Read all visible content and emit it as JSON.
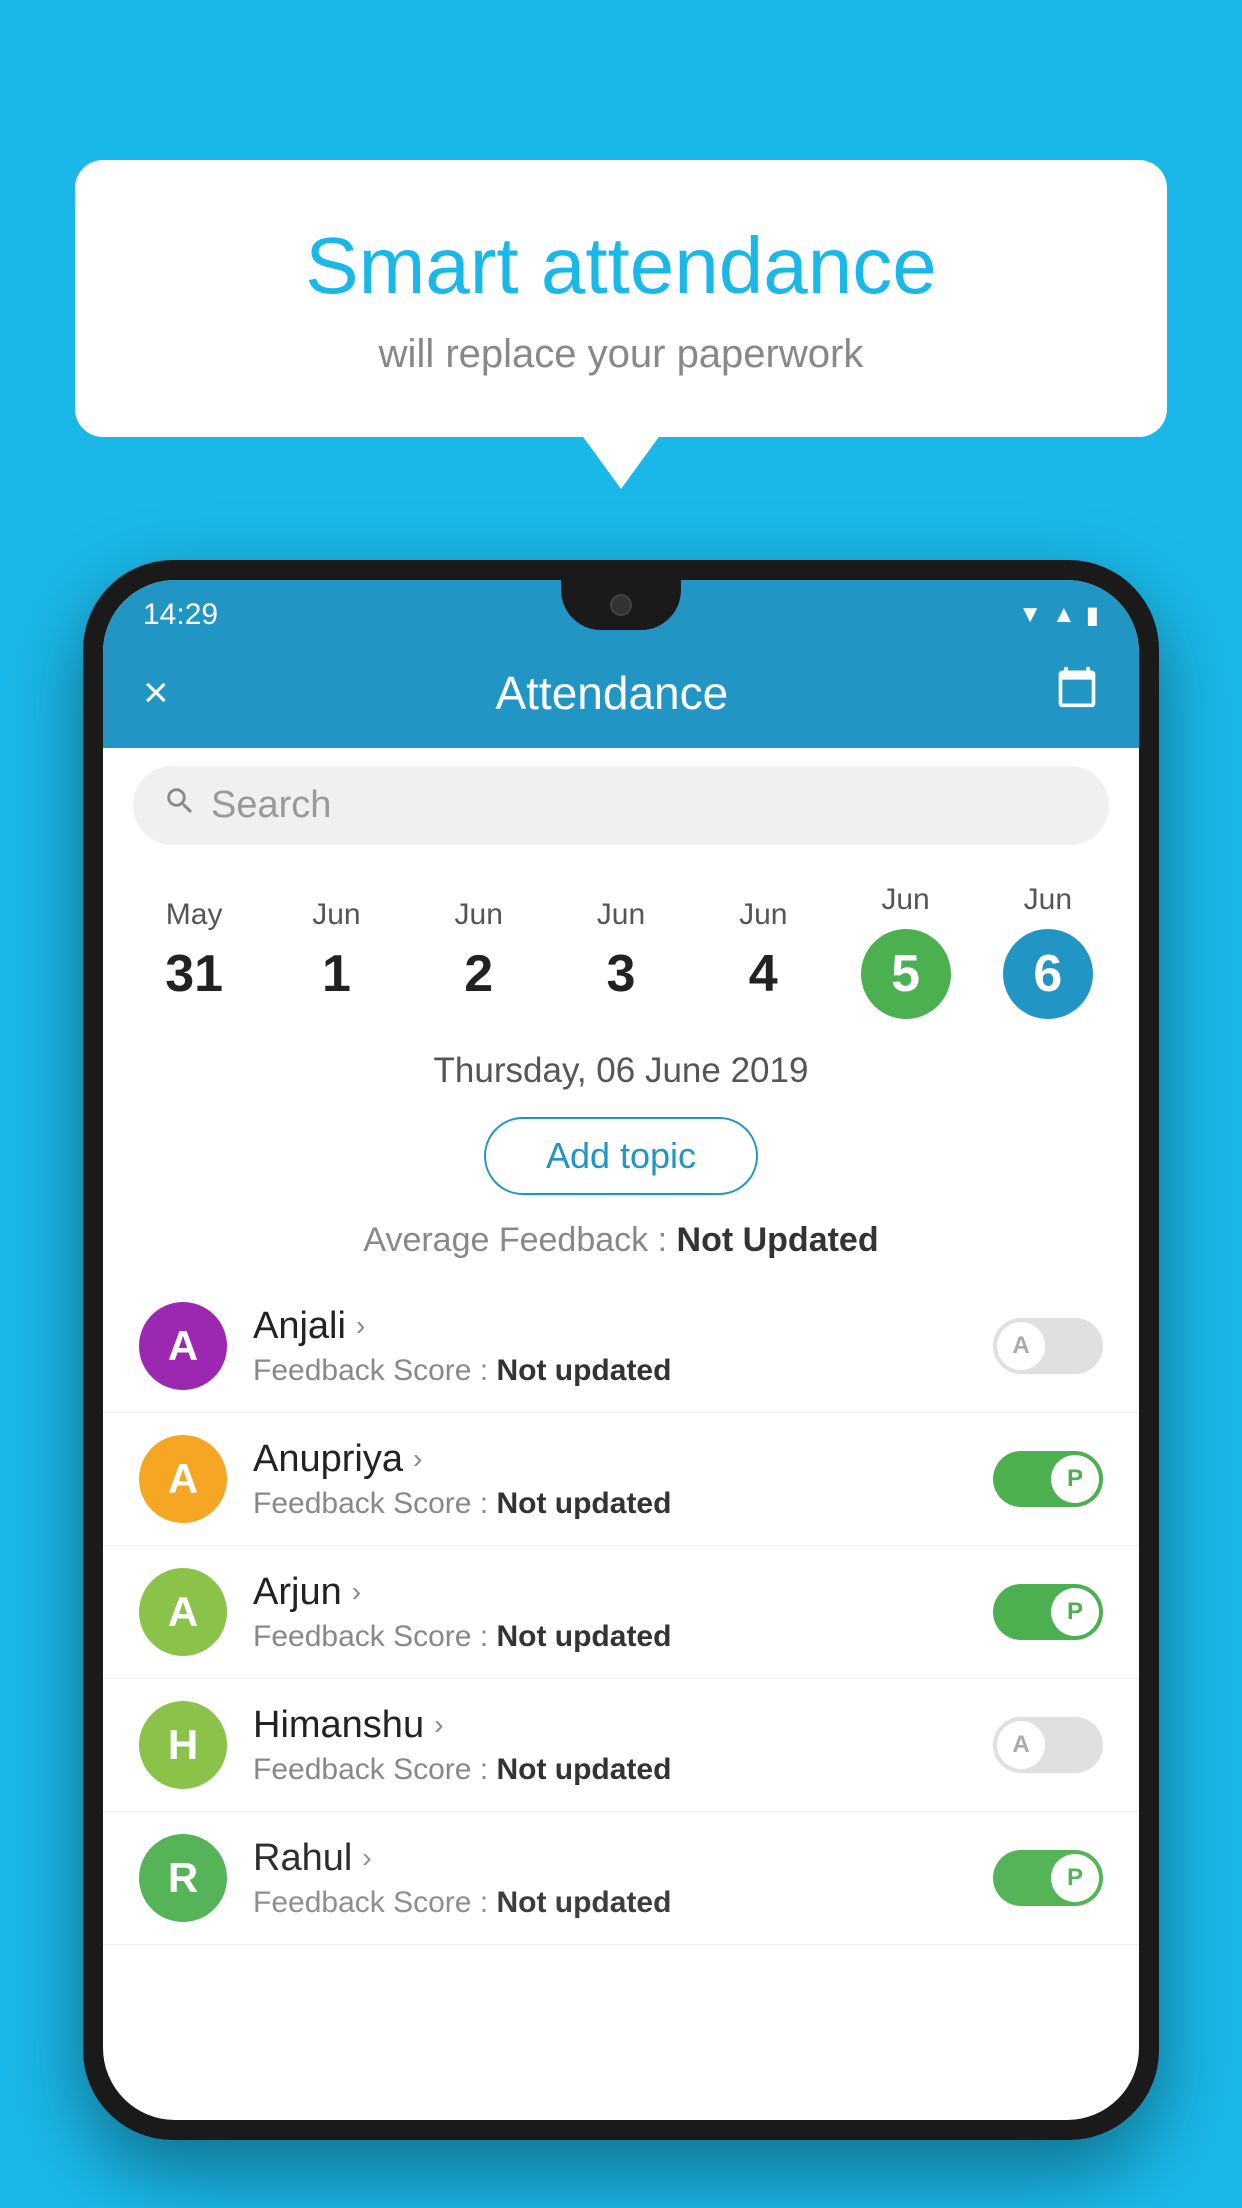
{
  "background_color": "#1ab8e8",
  "speech_bubble": {
    "title": "Smart attendance",
    "subtitle": "will replace your paperwork"
  },
  "phone": {
    "time": "14:29",
    "app_bar": {
      "title": "Attendance",
      "close_label": "×",
      "calendar_icon": "📅"
    },
    "search": {
      "placeholder": "Search"
    },
    "calendar": {
      "days": [
        {
          "month": "May",
          "date": "31",
          "state": "normal"
        },
        {
          "month": "Jun",
          "date": "1",
          "state": "normal"
        },
        {
          "month": "Jun",
          "date": "2",
          "state": "normal"
        },
        {
          "month": "Jun",
          "date": "3",
          "state": "normal"
        },
        {
          "month": "Jun",
          "date": "4",
          "state": "normal"
        },
        {
          "month": "Jun",
          "date": "5",
          "state": "today"
        },
        {
          "month": "Jun",
          "date": "6",
          "state": "selected"
        }
      ]
    },
    "selected_date": "Thursday, 06 June 2019",
    "add_topic_label": "Add topic",
    "avg_feedback_label": "Average Feedback :",
    "avg_feedback_value": "Not Updated",
    "students": [
      {
        "name": "Anjali",
        "avatar_letter": "A",
        "avatar_color": "#9c27b0",
        "feedback": "Not updated",
        "attendance": "absent"
      },
      {
        "name": "Anupriya",
        "avatar_letter": "A",
        "avatar_color": "#f5a623",
        "feedback": "Not updated",
        "attendance": "present"
      },
      {
        "name": "Arjun",
        "avatar_letter": "A",
        "avatar_color": "#8bc34a",
        "feedback": "Not updated",
        "attendance": "present"
      },
      {
        "name": "Himanshu",
        "avatar_letter": "H",
        "avatar_color": "#8bc34a",
        "feedback": "Not updated",
        "attendance": "absent"
      },
      {
        "name": "Rahul",
        "avatar_letter": "R",
        "avatar_color": "#4caf50",
        "feedback": "Not updated",
        "attendance": "present"
      }
    ],
    "feedback_score_label": "Feedback Score :",
    "present_toggle_label": "P",
    "absent_toggle_label": "A"
  }
}
